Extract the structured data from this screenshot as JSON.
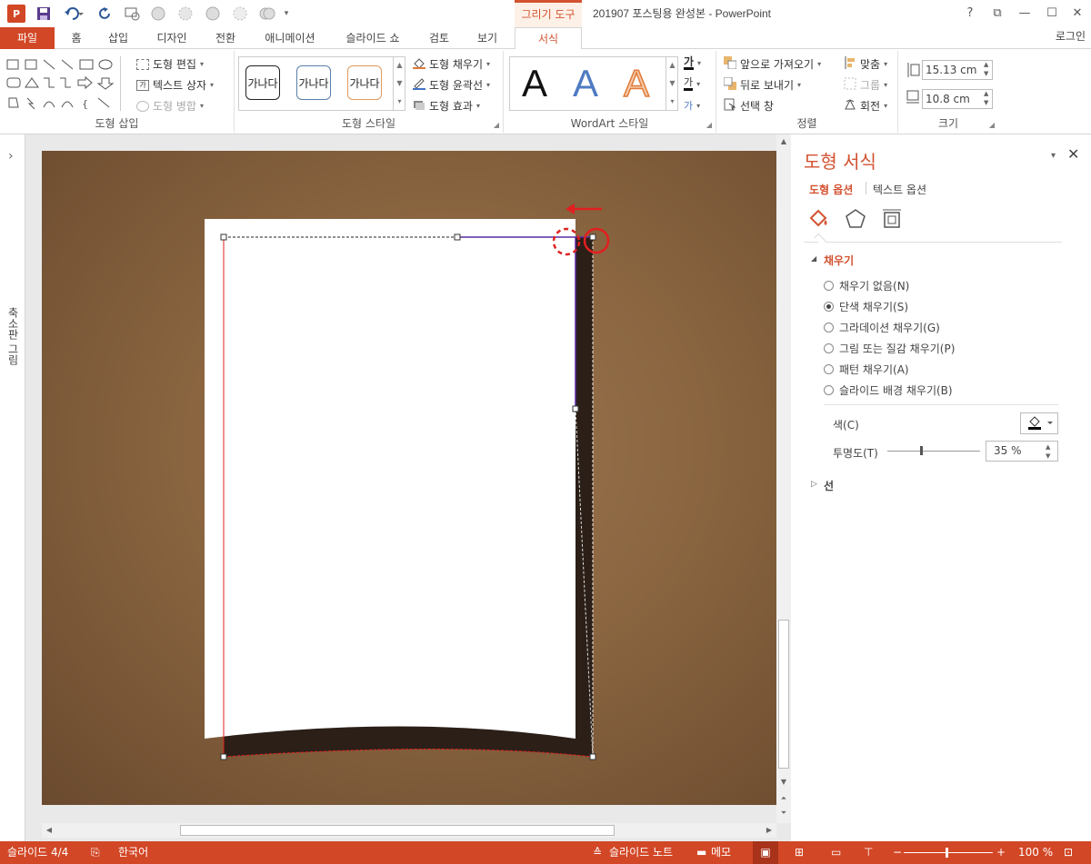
{
  "title_bar": {
    "logo": "P",
    "quick_access_icons": [
      "save-icon",
      "undo-icon",
      "redo-icon",
      "present-icon",
      "shape1-icon",
      "shape2-icon",
      "shape3-icon",
      "shape4-icon",
      "shape5-icon",
      "customize-icon"
    ],
    "context_tab": "그리기 도구",
    "document_title": "201907 포스팅용 완성본 - PowerPoint",
    "window_controls": [
      "?",
      "⧉",
      "—",
      "☐",
      "✕"
    ]
  },
  "tabs": [
    "파일",
    "홈",
    "삽입",
    "디자인",
    "전환",
    "애니메이션",
    "슬라이드 쇼",
    "검토",
    "보기",
    "서식"
  ],
  "login": "로그인",
  "ribbon": {
    "insert_shapes": {
      "label": "도형 삽입",
      "edit_shape": "도형 편집",
      "text_box": "텍스트 상자",
      "merge_shapes": "도형 병합"
    },
    "shape_styles": {
      "label": "도형 스타일",
      "thumbs": [
        "가나다",
        "가나다",
        "가나다"
      ],
      "fill": "도형 채우기",
      "outline": "도형 윤곽선",
      "effects": "도형 효과"
    },
    "wordart": {
      "label": "WordArt 스타일",
      "letters": [
        "A",
        "A",
        "A"
      ],
      "text_fill_glyph": "가"
    },
    "arrange": {
      "label": "정렬",
      "bring_forward": "앞으로 가져오기",
      "send_backward": "뒤로 보내기",
      "selection_pane": "선택 창",
      "align": "맞춤",
      "group": "그룹",
      "rotate": "회전"
    },
    "size": {
      "label": "크기",
      "height": "15.13 cm",
      "width": "10.8 cm"
    }
  },
  "left_pane": {
    "label": "축소판 그림",
    "expand": "›"
  },
  "format_pane": {
    "title": "도형 서식",
    "tab_shape": "도형 옵션",
    "tab_text": "텍스트 옵션",
    "fill_section": "채우기",
    "fill_options": [
      {
        "label": "채우기 없음(N)",
        "selected": false
      },
      {
        "label": "단색 채우기(S)",
        "selected": true
      },
      {
        "label": "그라데이션 채우기(G)",
        "selected": false
      },
      {
        "label": "그림 또는 질감 채우기(P)",
        "selected": false
      },
      {
        "label": "패턴 채우기(A)",
        "selected": false
      },
      {
        "label": "슬라이드 배경 채우기(B)",
        "selected": false
      }
    ],
    "color_label": "색(C)",
    "transparency_label": "투명도(T)",
    "transparency_value": "35 %",
    "transparency_level": 0.35,
    "line_section": "선"
  },
  "status": {
    "slide": "슬라이드 4/4",
    "language": "한국어",
    "notes": "슬라이드 노트",
    "comments": "메모",
    "zoom": "100 %"
  },
  "colors": {
    "accent": "#d24726",
    "slide_bg": "#8a6540",
    "shadow": "#2b1f18",
    "selection_red": "#e02020"
  }
}
